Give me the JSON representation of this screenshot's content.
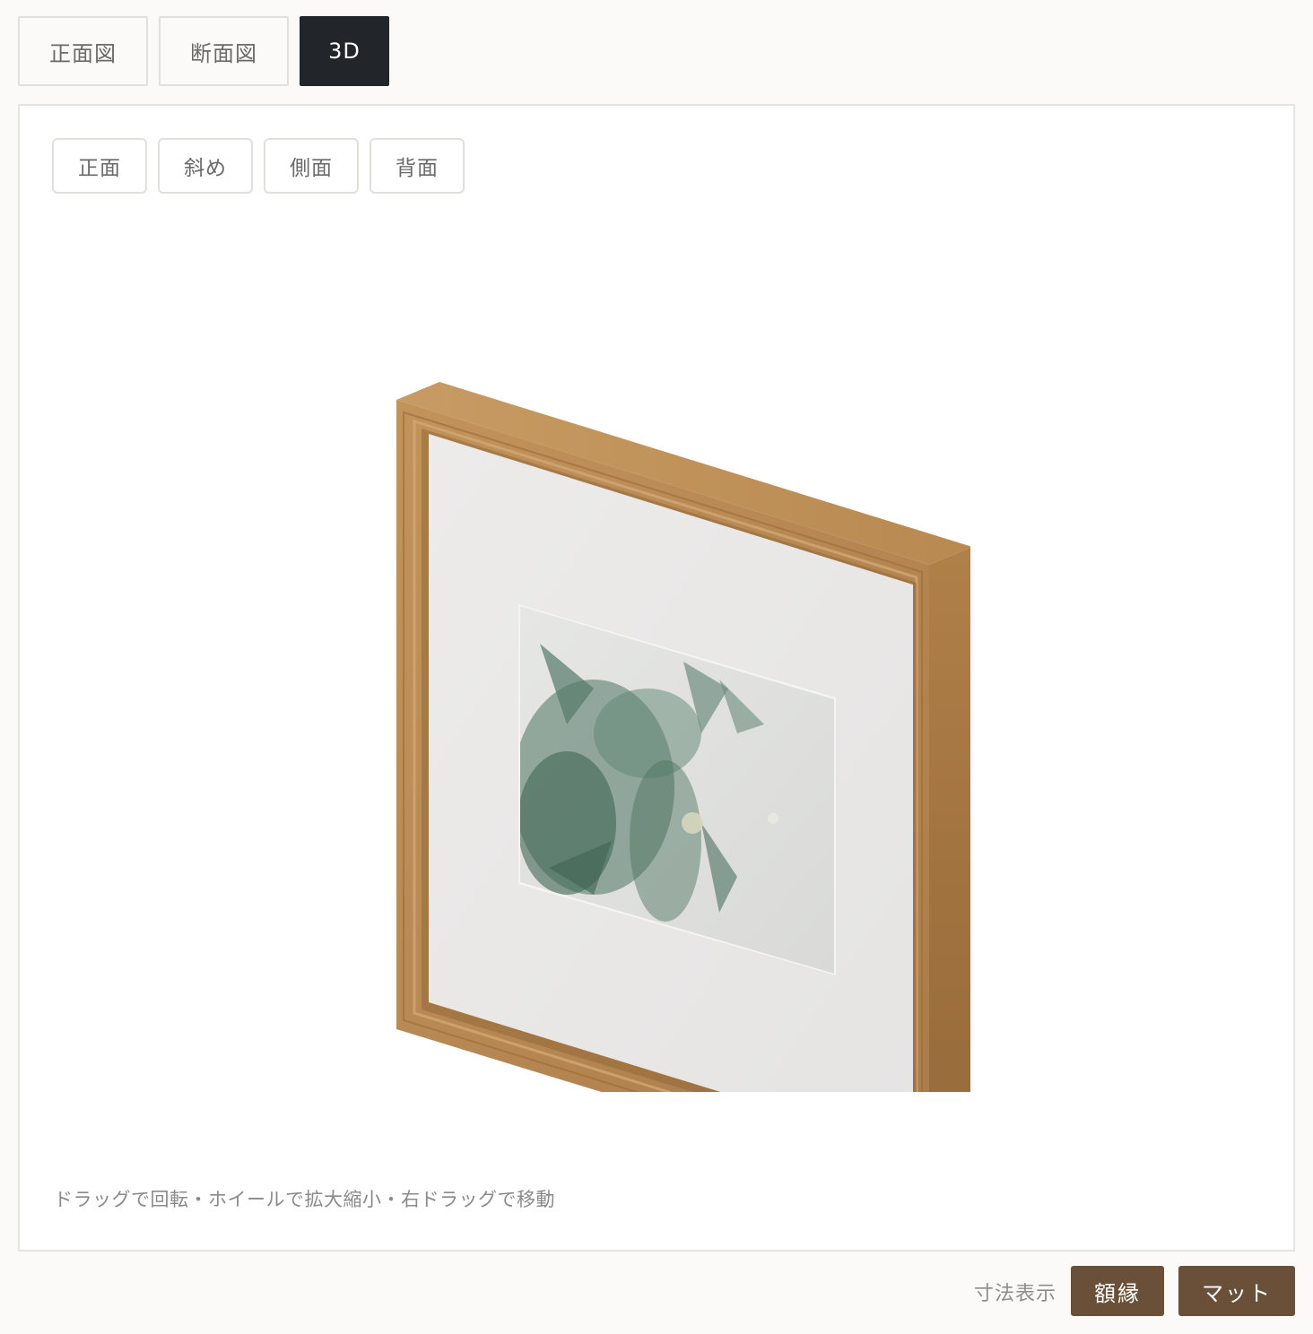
{
  "view_tabs": {
    "front": "正面図",
    "section": "断面図",
    "three_d": "3D",
    "active": "3D"
  },
  "viewer": {
    "angle_buttons": {
      "front": "正面",
      "oblique": "斜め",
      "side": "側面",
      "back": "背面"
    },
    "hint": "ドラッグで回転・ホイールで拡大縮小・右ドラッグで移動"
  },
  "dimensions": {
    "label": "寸法表示",
    "frame_button": "額縁",
    "mat_button": "マット"
  },
  "colors": {
    "active_tab": "#22252a",
    "dimension_button": "#6a5038",
    "frame_wood": "#b8894f",
    "mat": "#e8e7e6"
  }
}
